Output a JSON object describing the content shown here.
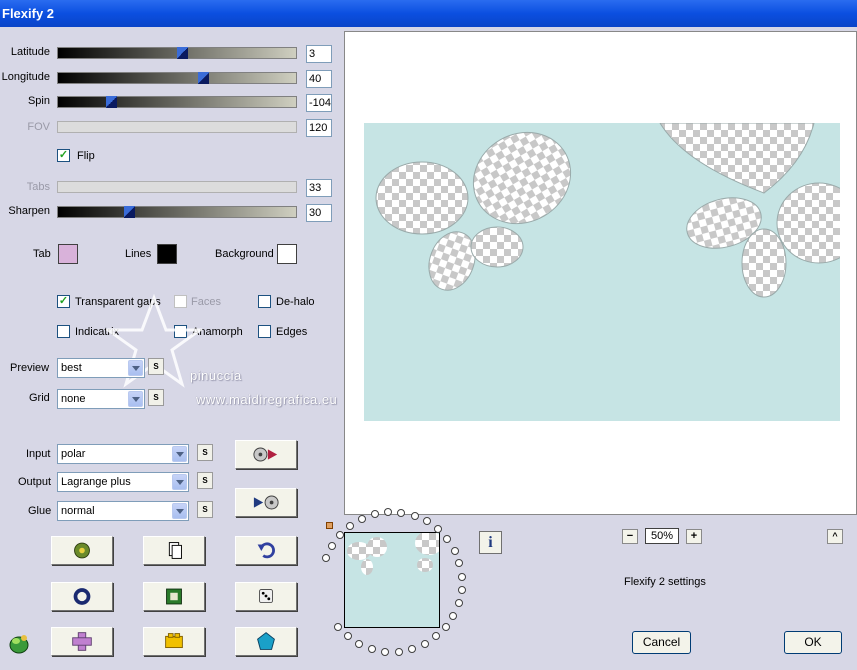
{
  "window": {
    "title": "Flexify 2"
  },
  "sliders": [
    {
      "label": "Latitude",
      "value": "3",
      "pos": 0.52,
      "enabled": true
    },
    {
      "label": "Longitude",
      "value": "40",
      "pos": 0.61,
      "enabled": true
    },
    {
      "label": "Spin",
      "value": "-104",
      "pos": 0.21,
      "enabled": true
    },
    {
      "label": "FOV",
      "value": "120",
      "pos": null,
      "enabled": false
    },
    {
      "label": "Tabs",
      "value": "33",
      "pos": null,
      "enabled": false
    },
    {
      "label": "Sharpen",
      "value": "30",
      "pos": 0.29,
      "enabled": true
    }
  ],
  "flip": {
    "label": "Flip",
    "checked": true
  },
  "colors": {
    "tab_label": "Tab",
    "tab_color": "#d9b2da",
    "lines_label": "Lines",
    "lines_color": "#000000",
    "background_label": "Background",
    "background_color": "#ffffff"
  },
  "options": {
    "transparent_gaps": {
      "label": "Transparent gaps",
      "checked": true
    },
    "faces": {
      "label": "Faces",
      "checked": false
    },
    "de_halo": {
      "label": "De-halo",
      "checked": false
    },
    "indicatrix": {
      "label": "Indicatrix",
      "checked": false
    },
    "anamorph": {
      "label": "Anamorph",
      "checked": false
    },
    "edges": {
      "label": "Edges",
      "checked": false
    }
  },
  "preview_select": {
    "label": "Preview",
    "value": "best"
  },
  "grid_select": {
    "label": "Grid",
    "value": "none"
  },
  "input_select": {
    "label": "Input",
    "value": "polar"
  },
  "output_select": {
    "label": "Output",
    "value": "Lagrange plus"
  },
  "glue_select": {
    "label": "Glue",
    "value": "normal"
  },
  "s_button": "S",
  "watermark": {
    "line1": "pinuccia",
    "line2": "www.maidiregrafica.eu"
  },
  "zoom": {
    "value": "50%",
    "minus": "−",
    "plus": "+"
  },
  "status": "Flexify 2 settings",
  "buttons": {
    "cancel": "Cancel",
    "ok": "OK",
    "info": "i",
    "collapse": "^"
  }
}
